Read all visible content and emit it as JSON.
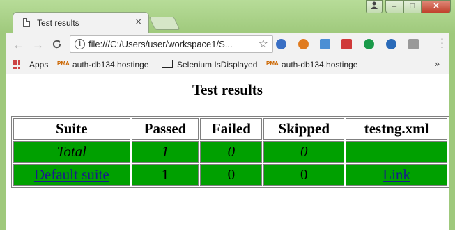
{
  "browser": {
    "tab_title": "Test results",
    "tab_close": "×",
    "controls": {
      "minimize": "–",
      "maximize": "□",
      "close": "✕"
    },
    "nav": {
      "back": "←",
      "forward": "→",
      "reload": "C"
    },
    "address": "file:///C:/Users/user/workspace1/S...",
    "star": "☆",
    "extensions": [
      {
        "name": "sync-ext-icon",
        "color": "#3a6fc4"
      },
      {
        "name": "firefox-ext-icon",
        "color": "#e07b1f"
      },
      {
        "name": "folder-ext-icon",
        "color": "#4b8fd4"
      },
      {
        "name": "bar-ext-icon",
        "color": "#d03a3a"
      },
      {
        "name": "check-ext-icon",
        "color": "#1a9a4a"
      },
      {
        "name": "shield-ext-icon",
        "color": "#2a6ab8"
      },
      {
        "name": "cube-ext-icon",
        "color": "#999999"
      }
    ],
    "bookmarks": {
      "apps": "Apps",
      "item1": "auth-db134.hostinge",
      "item2": "Selenium IsDisplayed",
      "item3": "auth-db134.hostinge",
      "more": "»"
    }
  },
  "page": {
    "heading": "Test results",
    "columns": [
      "Suite",
      "Passed",
      "Failed",
      "Skipped",
      "testng.xml"
    ],
    "total_row": {
      "suite": "Total",
      "passed": "1",
      "failed": "0",
      "skipped": "0",
      "xml": ""
    },
    "suite_row": {
      "suite": "Default suite",
      "passed": "1",
      "failed": "0",
      "skipped": "0",
      "xml": "Link"
    },
    "cell_color": "#00a000"
  }
}
